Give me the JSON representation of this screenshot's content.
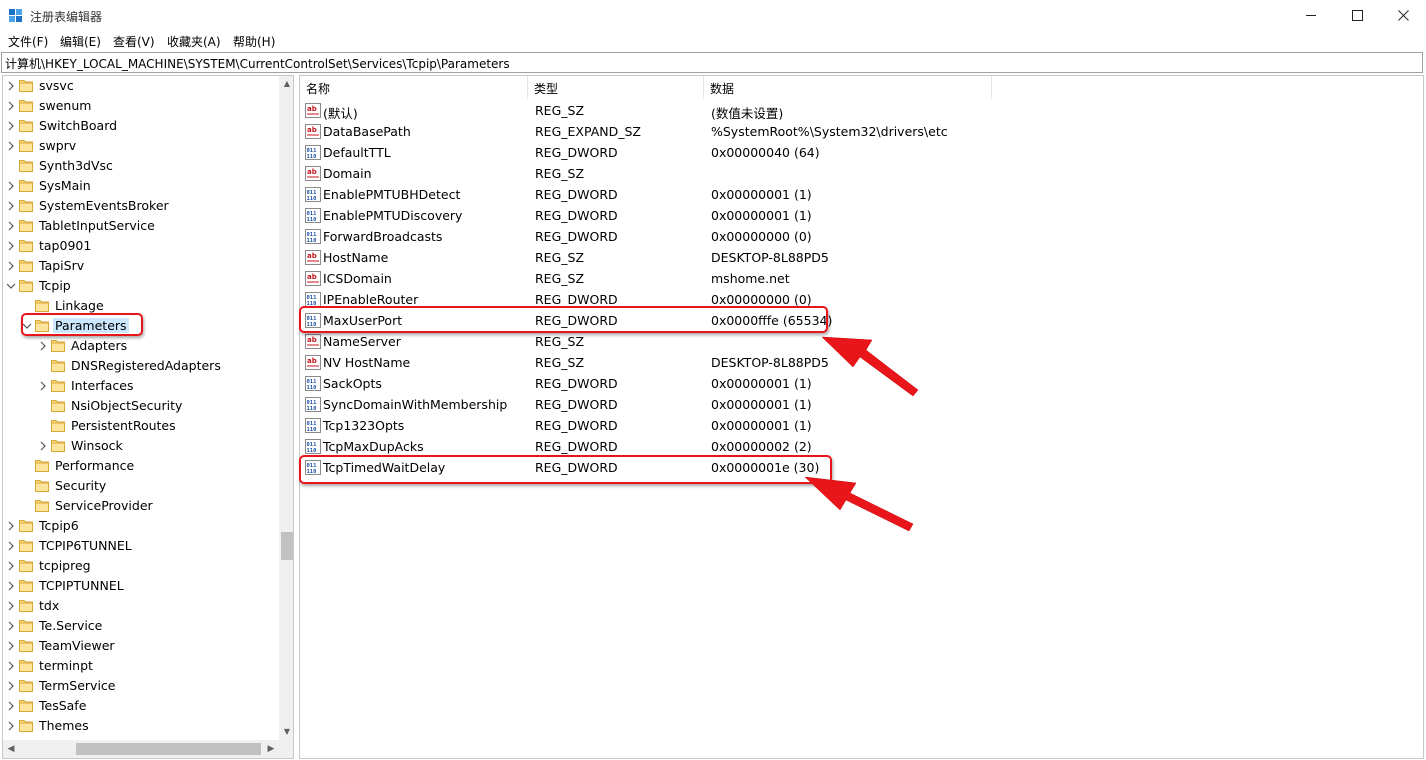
{
  "window": {
    "title": "注册表编辑器",
    "accent": "#1a73c8"
  },
  "menu": [
    "文件(F)",
    "编辑(E)",
    "查看(V)",
    "收藏夹(A)",
    "帮助(H)"
  ],
  "address": "计算机\\HKEY_LOCAL_MACHINE\\SYSTEM\\CurrentControlSet\\Services\\Tcpip\\Parameters",
  "tree": [
    {
      "label": "svsvc",
      "level": 0,
      "expander": "collapsed"
    },
    {
      "label": "swenum",
      "level": 0,
      "expander": "collapsed"
    },
    {
      "label": "SwitchBoard",
      "level": 0,
      "expander": "collapsed"
    },
    {
      "label": "swprv",
      "level": 0,
      "expander": "collapsed"
    },
    {
      "label": "Synth3dVsc",
      "level": 0,
      "expander": "none"
    },
    {
      "label": "SysMain",
      "level": 0,
      "expander": "collapsed"
    },
    {
      "label": "SystemEventsBroker",
      "level": 0,
      "expander": "collapsed"
    },
    {
      "label": "TabletInputService",
      "level": 0,
      "expander": "collapsed"
    },
    {
      "label": "tap0901",
      "level": 0,
      "expander": "collapsed"
    },
    {
      "label": "TapiSrv",
      "level": 0,
      "expander": "collapsed"
    },
    {
      "label": "Tcpip",
      "level": 0,
      "expander": "expanded"
    },
    {
      "label": "Linkage",
      "level": 1,
      "expander": "none"
    },
    {
      "label": "Parameters",
      "level": 1,
      "expander": "expanded",
      "selected": true
    },
    {
      "label": "Adapters",
      "level": 2,
      "expander": "collapsed"
    },
    {
      "label": "DNSRegisteredAdapters",
      "level": 2,
      "expander": "none"
    },
    {
      "label": "Interfaces",
      "level": 2,
      "expander": "collapsed"
    },
    {
      "label": "NsiObjectSecurity",
      "level": 2,
      "expander": "none"
    },
    {
      "label": "PersistentRoutes",
      "level": 2,
      "expander": "none"
    },
    {
      "label": "Winsock",
      "level": 2,
      "expander": "collapsed"
    },
    {
      "label": "Performance",
      "level": 1,
      "expander": "none"
    },
    {
      "label": "Security",
      "level": 1,
      "expander": "none"
    },
    {
      "label": "ServiceProvider",
      "level": 1,
      "expander": "none"
    },
    {
      "label": "Tcpip6",
      "level": 0,
      "expander": "collapsed"
    },
    {
      "label": "TCPIP6TUNNEL",
      "level": 0,
      "expander": "collapsed"
    },
    {
      "label": "tcpipreg",
      "level": 0,
      "expander": "collapsed"
    },
    {
      "label": "TCPIPTUNNEL",
      "level": 0,
      "expander": "collapsed"
    },
    {
      "label": "tdx",
      "level": 0,
      "expander": "collapsed"
    },
    {
      "label": "Te.Service",
      "level": 0,
      "expander": "collapsed"
    },
    {
      "label": "TeamViewer",
      "level": 0,
      "expander": "collapsed"
    },
    {
      "label": "terminpt",
      "level": 0,
      "expander": "collapsed"
    },
    {
      "label": "TermService",
      "level": 0,
      "expander": "collapsed"
    },
    {
      "label": "TesSafe",
      "level": 0,
      "expander": "collapsed"
    },
    {
      "label": "Themes",
      "level": 0,
      "expander": "collapsed"
    }
  ],
  "columns": [
    "名称",
    "类型",
    "数据"
  ],
  "values": [
    {
      "icon": "string-value-icon",
      "name": "(默认)",
      "type": "REG_SZ",
      "data": "(数值未设置)"
    },
    {
      "icon": "string-value-icon",
      "name": "DataBasePath",
      "type": "REG_EXPAND_SZ",
      "data": "%SystemRoot%\\System32\\drivers\\etc"
    },
    {
      "icon": "binary-value-icon",
      "name": "DefaultTTL",
      "type": "REG_DWORD",
      "data": "0x00000040 (64)"
    },
    {
      "icon": "string-value-icon",
      "name": "Domain",
      "type": "REG_SZ",
      "data": ""
    },
    {
      "icon": "binary-value-icon",
      "name": "EnablePMTUBHDetect",
      "type": "REG_DWORD",
      "data": "0x00000001 (1)"
    },
    {
      "icon": "binary-value-icon",
      "name": "EnablePMTUDiscovery",
      "type": "REG_DWORD",
      "data": "0x00000001 (1)"
    },
    {
      "icon": "binary-value-icon",
      "name": "ForwardBroadcasts",
      "type": "REG_DWORD",
      "data": "0x00000000 (0)"
    },
    {
      "icon": "string-value-icon",
      "name": "HostName",
      "type": "REG_SZ",
      "data": "DESKTOP-8L88PD5"
    },
    {
      "icon": "string-value-icon",
      "name": "ICSDomain",
      "type": "REG_SZ",
      "data": "mshome.net"
    },
    {
      "icon": "binary-value-icon",
      "name": "IPEnableRouter",
      "type": "REG_DWORD",
      "data": "0x00000000 (0)"
    },
    {
      "icon": "binary-value-icon",
      "name": "MaxUserPort",
      "type": "REG_DWORD",
      "data": "0x0000fffe (65534)",
      "highlight": true
    },
    {
      "icon": "string-value-icon",
      "name": "NameServer",
      "type": "REG_SZ",
      "data": ""
    },
    {
      "icon": "string-value-icon",
      "name": "NV HostName",
      "type": "REG_SZ",
      "data": "DESKTOP-8L88PD5"
    },
    {
      "icon": "binary-value-icon",
      "name": "SackOpts",
      "type": "REG_DWORD",
      "data": "0x00000001 (1)"
    },
    {
      "icon": "binary-value-icon",
      "name": "SyncDomainWithMembership",
      "type": "REG_DWORD",
      "data": "0x00000001 (1)"
    },
    {
      "icon": "binary-value-icon",
      "name": "Tcp1323Opts",
      "type": "REG_DWORD",
      "data": "0x00000001 (1)"
    },
    {
      "icon": "binary-value-icon",
      "name": "TcpMaxDupAcks",
      "type": "REG_DWORD",
      "data": "0x00000002 (2)"
    },
    {
      "icon": "binary-value-icon",
      "name": "TcpTimedWaitDelay",
      "type": "REG_DWORD",
      "data": "0x0000001e (30)",
      "highlight": true
    }
  ],
  "annotation_color": "#e8161b"
}
